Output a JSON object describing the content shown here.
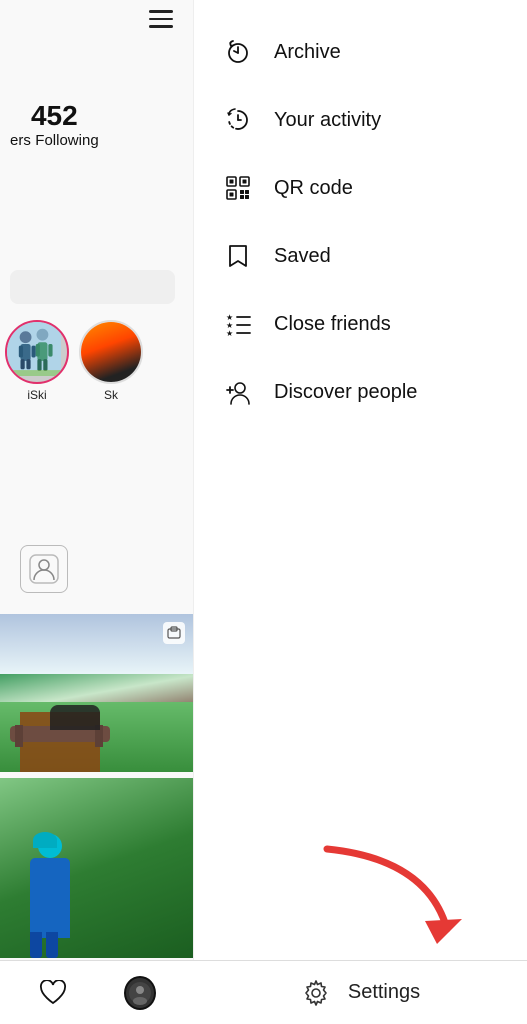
{
  "left": {
    "following_count": "452",
    "following_label": "Following",
    "followers_label": "ers",
    "stories": [
      {
        "label": "iSki"
      },
      {
        "label": "Sk"
      }
    ]
  },
  "menu": {
    "items": [
      {
        "id": "archive",
        "label": "Archive"
      },
      {
        "id": "your-activity",
        "label": "Your activity"
      },
      {
        "id": "qr-code",
        "label": "QR code"
      },
      {
        "id": "saved",
        "label": "Saved"
      },
      {
        "id": "close-friends",
        "label": "Close friends"
      },
      {
        "id": "discover-people",
        "label": "Discover people"
      }
    ]
  },
  "bottom": {
    "settings_label": "Settings"
  }
}
